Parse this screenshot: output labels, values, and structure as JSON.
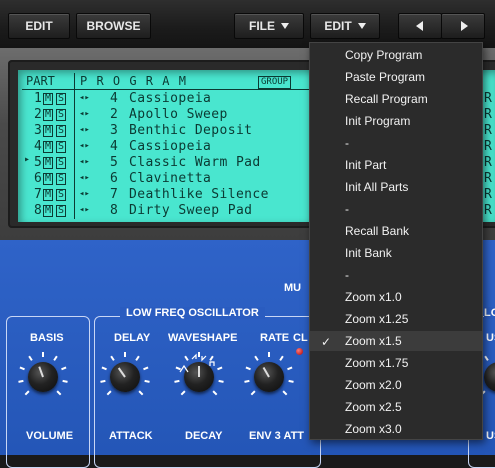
{
  "toolbar": {
    "edit_label": "EDIT",
    "browse_label": "BROWSE",
    "file_label": "FILE",
    "edit_menu_label": "EDIT"
  },
  "lcd": {
    "part_header": "PART",
    "program_header": "P R O G R A M",
    "group_label": "GROUP",
    "mute_label": "M",
    "solo_label": "S",
    "rows": [
      {
        "part": "1",
        "num": "4",
        "name": "Cassiopeia",
        "selected": false
      },
      {
        "part": "2",
        "num": "2",
        "name": "Apollo Sweep",
        "selected": false
      },
      {
        "part": "3",
        "num": "3",
        "name": "Benthic Deposit",
        "selected": false
      },
      {
        "part": "4",
        "num": "4",
        "name": "Cassiopeia",
        "selected": false
      },
      {
        "part": "5",
        "num": "5",
        "name": "Classic Warm Pad",
        "selected": true
      },
      {
        "part": "6",
        "num": "6",
        "name": "Clavinetta",
        "selected": false
      },
      {
        "part": "7",
        "num": "7",
        "name": "Deathlike Silence",
        "selected": false
      },
      {
        "part": "8",
        "num": "8",
        "name": "Dirty Sweep Pad",
        "selected": false
      }
    ]
  },
  "panel": {
    "lfo_title": "LOW FREQ OSCILLATOR",
    "mu_label": "MU",
    "basis_label": "BASIS",
    "delay_label": "DELAY",
    "waveshape_label": "WAVESHAPE",
    "rate_label": "RATE",
    "cl_label": "CL",
    "lo_label": "LO",
    "us_label": "US",
    "volume_label": "VOLUME",
    "attack_label": "ATTACK",
    "decay_label": "DECAY",
    "env3_label": "ENV 3 ATT"
  },
  "menu": {
    "items": [
      {
        "label": "Copy Program",
        "checked": false
      },
      {
        "label": "Paste Program",
        "checked": false
      },
      {
        "label": "Recall Program",
        "checked": false
      },
      {
        "label": "Init Program",
        "checked": false
      },
      {
        "label": "-",
        "checked": false
      },
      {
        "label": "Init Part",
        "checked": false
      },
      {
        "label": "Init All Parts",
        "checked": false
      },
      {
        "label": "-",
        "checked": false
      },
      {
        "label": "Recall Bank",
        "checked": false
      },
      {
        "label": "Init Bank",
        "checked": false
      },
      {
        "label": "-",
        "checked": false
      },
      {
        "label": "Zoom x1.0",
        "checked": false
      },
      {
        "label": "Zoom x1.25",
        "checked": false
      },
      {
        "label": "Zoom x1.5",
        "checked": true
      },
      {
        "label": "Zoom x1.75",
        "checked": false
      },
      {
        "label": "Zoom x2.0",
        "checked": false
      },
      {
        "label": "Zoom x2.5",
        "checked": false
      },
      {
        "label": "Zoom x3.0",
        "checked": false
      }
    ],
    "check_mark": "✓"
  },
  "colors": {
    "lcd_bg": "#49e6cf",
    "panel_blue": "#2f63c8",
    "menu_bg": "#2b2b2b"
  }
}
